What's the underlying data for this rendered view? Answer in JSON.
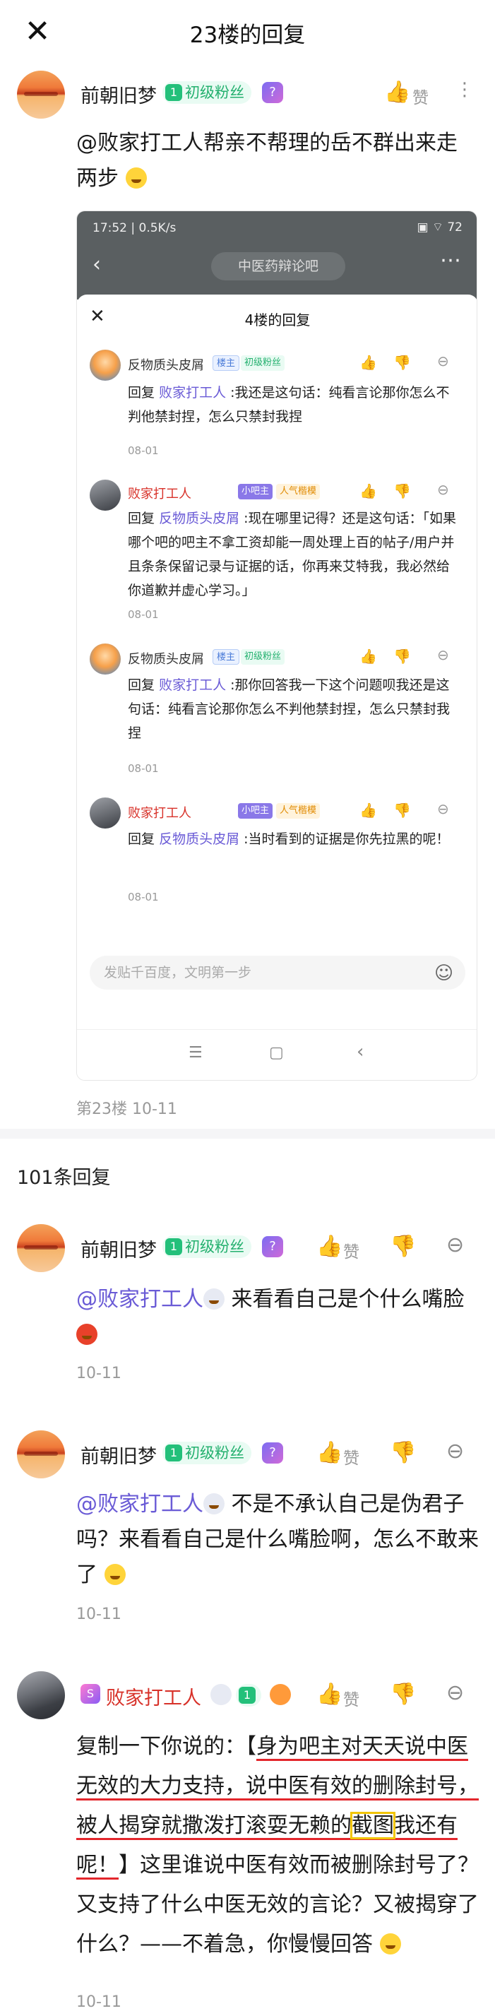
{
  "header": {
    "title": "23楼的回复",
    "close_icon": "close-icon"
  },
  "main_post": {
    "username": "前朝旧梦",
    "badge_level": "1",
    "badge_label": "初级粉丝",
    "like_label": "赞",
    "text": "@败家打工人帮亲不帮理的岳不群出来走两步",
    "floor": "第23楼",
    "date": "10-11",
    "screenshot": {
      "status_time": "17:52 | 0.5K/s",
      "status_right": "▣ ⌔ 72",
      "forum": "中医药辩论吧",
      "panel_title": "4楼的回复",
      "input_placeholder": "发贴千百度，文明第一步",
      "replies": [
        {
          "name": "反物质头皮屑",
          "tag1": "楼主",
          "tag2": "初级粉丝",
          "reply_label": "回复",
          "reply_to": "败家打工人",
          "text": ":我还是这句话：纯看言论那你怎么不判他禁封捏，怎么只禁封我捏",
          "date": "08-01"
        },
        {
          "name": "败家打工人",
          "tag1": "小吧主",
          "tag2": "人气楷模",
          "reply_label": "回复",
          "reply_to": "反物质头皮屑",
          "text": ":现在哪里记得？还是这句话：「如果哪个吧的吧主不拿工资却能一周处理上百的帖子/用户并且条条保留记录与证据的话，你再来艾特我，我必然给你道歉并虚心学习。」",
          "date": "08-01"
        },
        {
          "name": "反物质头皮屑",
          "tag1": "楼主",
          "tag2": "初级粉丝",
          "reply_label": "回复",
          "reply_to": "败家打工人",
          "text": ":那你回答我一下这个问题呗我还是这句话：纯看言论那你怎么不判他禁封捏，怎么只禁封我捏",
          "date": "08-01"
        },
        {
          "name": "败家打工人",
          "tag1": "小吧主",
          "tag2": "人气楷模",
          "reply_label": "回复",
          "reply_to": "反物质头皮屑",
          "text": ":当时看到的证据是你先拉黑的呢！",
          "date": "08-01"
        }
      ]
    }
  },
  "replies_count_label": "101条回复",
  "comments": [
    {
      "username": "前朝旧梦",
      "badge_level": "1",
      "badge_label": "初级粉丝",
      "like_label": "赞",
      "mention": "@败家打工人",
      "text": " 来看看自己是个什么嘴脸",
      "date": "10-11"
    },
    {
      "username": "前朝旧梦",
      "badge_level": "1",
      "badge_label": "初级粉丝",
      "like_label": "赞",
      "mention": "@败家打工人",
      "text": " 不是不承认自己是伪君子吗？来看看自己是什么嘴脸啊，怎么不敢来了",
      "date": "10-11"
    },
    {
      "username": "败家打工人",
      "badge_level": "1",
      "like_label": "赞",
      "text_prefix": "复制一下你说的：【",
      "text_hl1": "身为吧主对天天说中医无效的大力支持，说中医有效的删除封号，被人揭穿就撒泼打滚耍无赖的",
      "text_box": "截图",
      "text_hl2": "我还有呢！",
      "text_rest": "】这里谁说中医有效而被删除封号了？又支持了什么中医无效的言论？又被揭穿了什么？——不着急，你慢慢回答",
      "date": "10-11"
    }
  ],
  "colors": {
    "accent": "#6a5bd6",
    "badge_green": "#23b06e",
    "highlight_red": "#e3262c",
    "box_yellow": "#f2c500"
  }
}
